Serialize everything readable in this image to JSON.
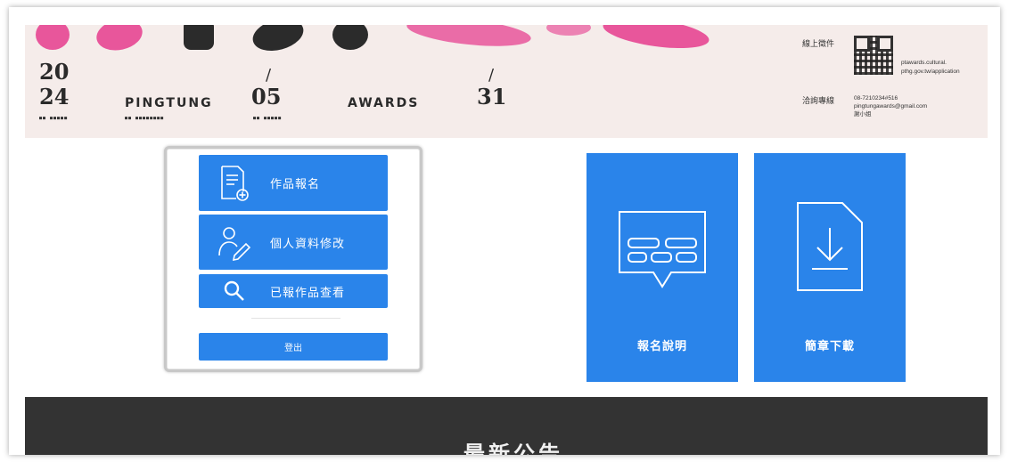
{
  "banner": {
    "year_top": "20",
    "year_bottom": "24",
    "word_left": "PINGTUNG",
    "month": "05",
    "word_right": "AWARDS",
    "day": "31",
    "slash": "/",
    "tiny_1": "■■ ■■■■■",
    "tiny_2": "■■ ■■■■■■■■",
    "tiny_3": "■■ ■■■■■",
    "online_label": "線上徵件",
    "online_url_1": "ptawards.cultural.",
    "online_url_2": "pthg.gov.tw/application",
    "contact_label": "洽詢專線",
    "contact_phone": "08-7210234#516",
    "contact_email": "pingtungawards@gmail.com",
    "contact_name": "謝小姐"
  },
  "panel": {
    "register_label": "作品報名",
    "profile_label": "個人資料修改",
    "submitted_label": "已報作品查看",
    "logout_label": "登出"
  },
  "tiles": {
    "guide_label": "報名說明",
    "download_label": "簡章下載"
  },
  "footer": {
    "title": "最新公告"
  },
  "colors": {
    "primary": "#2a84ea",
    "banner_bg": "#f5ecea",
    "footer_bg": "#333333",
    "accent_pink": "#e8569b"
  }
}
